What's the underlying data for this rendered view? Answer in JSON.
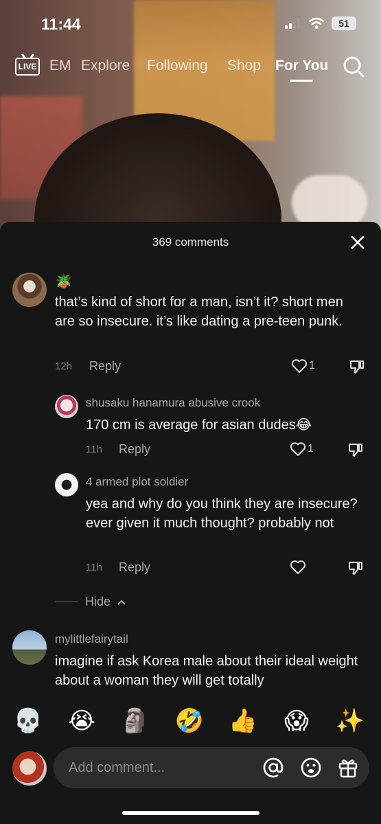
{
  "status_bar": {
    "time": "11:44",
    "battery": "51"
  },
  "top_nav": {
    "live_label": "LIVE",
    "tabs": [
      {
        "label": "EM"
      },
      {
        "label": "Explore"
      },
      {
        "label": "Following"
      },
      {
        "label": "Shop"
      },
      {
        "label": "For You",
        "active": true
      }
    ]
  },
  "comments_panel": {
    "title": "369 comments",
    "comments": [
      {
        "username_emoji": "🪴",
        "text": "that’s kind of short for a man, isn’t it? short men are so insecure. it’s like dating a pre-teen punk.",
        "time": "12h",
        "reply_label": "Reply",
        "likes": "1"
      },
      {
        "username": "shusaku hanamura abusive crook",
        "text": "170 cm is average for asian dudes😂",
        "time": "11h",
        "reply_label": "Reply",
        "likes": "1"
      },
      {
        "username": "4 armed plot soldier",
        "text": "yea and why do you think they are insecure? ever given it much thought? probably not",
        "time": "11h",
        "reply_label": "Reply",
        "likes": ""
      },
      {
        "username": "mylittlefairytail",
        "text": "imagine if ask Korea male about their ideal weight about a woman they will get totally"
      }
    ],
    "hide_label": "Hide"
  },
  "emoji_bar": [
    "💀",
    "😭",
    "🗿",
    "🤣",
    "👍",
    "😱",
    "✨"
  ],
  "input": {
    "placeholder": "Add comment..."
  },
  "colors": {
    "sheet_bg": "#161616",
    "input_bg": "#2c2c2c",
    "muted_text": "#a8a8a8"
  }
}
